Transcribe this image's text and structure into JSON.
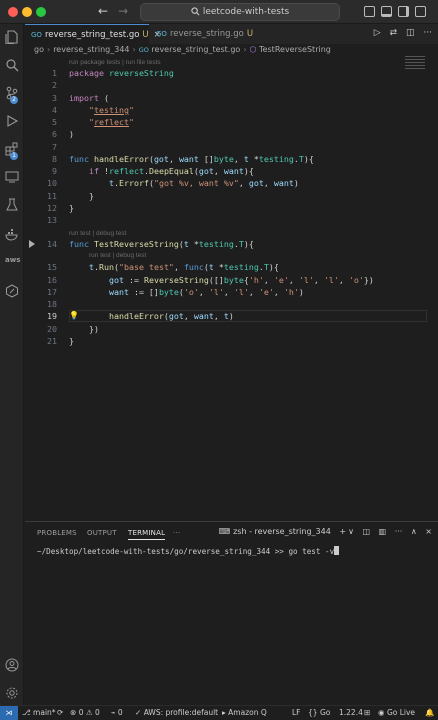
{
  "window": {
    "search_text": "leetcode-with-tests",
    "back_arrow": "←",
    "forward_arrow": "→"
  },
  "tabs": [
    {
      "label": "reverse_string_test.go",
      "badge": "GO",
      "modified": "U",
      "close": "×",
      "active": true
    },
    {
      "label": "reverse_string.go",
      "badge": "GO",
      "modified": "U",
      "active": false
    }
  ],
  "breadcrumb": {
    "items": [
      "go",
      "reverse_string_344",
      "reverse_string_test.go",
      "TestReverseString"
    ],
    "file_badge": "GO",
    "func_icon": "⬡",
    "separator": "›"
  },
  "editor": {
    "codelens_top": "run package tests | run file tests",
    "codelens_test": "run test | debug test",
    "codelens_subtest": "run test | debug test",
    "line_numbers": [
      "1",
      "2",
      "3",
      "4",
      "5",
      "6",
      "7",
      "8",
      "9",
      "10",
      "11",
      "12",
      "13",
      "14",
      "15",
      "16",
      "17",
      "18",
      "19",
      "20",
      "21"
    ],
    "current_line": "19"
  },
  "panel": {
    "tabs": [
      "PROBLEMS",
      "OUTPUT",
      "TERMINAL",
      "···"
    ],
    "active_tab": "TERMINAL",
    "terminal_name": "zsh - reverse_string_344",
    "terminal_prompt": "~/Desktop/leetcode-with-tests/go/reverse_string_344 >> go test -v",
    "actions": [
      "+",
      "∨",
      "🗑",
      "···",
      "∧",
      "×"
    ]
  },
  "status": {
    "remote_icon": "⋊",
    "branch": "main*",
    "sync_icon": "⟳",
    "errors": "0",
    "warnings": "0",
    "ports": "0",
    "aws": "AWS: profile:default",
    "amazon_q": "Amazon Q",
    "eol": "LF",
    "language": "Go",
    "go_version": "1.22.4",
    "go_live": "Go Live",
    "bell_icon": "🔔"
  },
  "colors": {
    "accent": "#4d8cd0",
    "background": "#1e1e1e",
    "keyword": "#c586c0",
    "function": "#dcdcaa",
    "string": "#ce9178",
    "type": "#4ec9b0"
  }
}
